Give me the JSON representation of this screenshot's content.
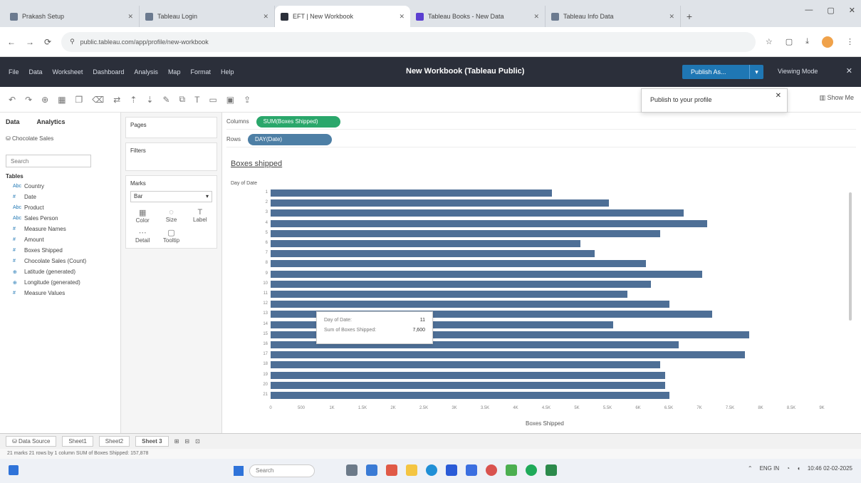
{
  "browser": {
    "tabs": [
      {
        "title": "Prakash Setup"
      },
      {
        "title": "Tableau Login"
      },
      {
        "title": "EFT | New Workbook"
      },
      {
        "title": "Tableau Books - New Data"
      },
      {
        "title": "Tableau Info Data"
      }
    ],
    "url": "public.tableau.com/app/profile/new-workbook",
    "new_tab": "+"
  },
  "tableau": {
    "menus": [
      "File",
      "Data",
      "Worksheet",
      "Dashboard",
      "Analysis",
      "Map",
      "Format",
      "Help"
    ],
    "workbook_title": "New Workbook (Tableau Public)",
    "publish_label": "Publish As...",
    "user": "Viewing Mode",
    "publish_tooltip": "Publish to your profile",
    "show_me": "Show Me"
  },
  "data_pane": {
    "tab_data": "Data",
    "tab_analytics": "Analytics",
    "source": "Chocolate Sales",
    "search_placeholder": "Search",
    "tables_label": "Tables",
    "fields": [
      {
        "type": "Abc",
        "name": "Country"
      },
      {
        "type": "#",
        "name": "Date"
      },
      {
        "type": "Abc",
        "name": "Product"
      },
      {
        "type": "Abc",
        "name": "Sales Person"
      },
      {
        "type": "#",
        "name": "Measure Names"
      },
      {
        "type": "#",
        "name": "Amount"
      },
      {
        "type": "#",
        "name": "Boxes Shipped"
      },
      {
        "type": "#",
        "name": "Chocolate Sales (Count)"
      },
      {
        "type": "⊕",
        "name": "Latitude (generated)"
      },
      {
        "type": "⊕",
        "name": "Longitude (generated)"
      },
      {
        "type": "#",
        "name": "Measure Values"
      }
    ]
  },
  "cards": {
    "pages": "Pages",
    "filters": "Filters",
    "marks": "Marks",
    "mark_type": "Bar",
    "mark_buttons": [
      {
        "icon": "▦",
        "label": "Color"
      },
      {
        "icon": "◌",
        "label": "Size"
      },
      {
        "icon": "T",
        "label": "Label"
      },
      {
        "icon": "⋯",
        "label": "Detail"
      },
      {
        "icon": "▢",
        "label": "Tooltip"
      }
    ]
  },
  "shelves": {
    "columns_label": "Columns",
    "columns_pill": "SUM(Boxes Shipped)",
    "rows_label": "Rows",
    "rows_pill": "DAY(Date)"
  },
  "chart_data": {
    "type": "bar",
    "title": "Boxes shipped",
    "ylabel": "Day of Date",
    "xlabel": "Boxes Shipped",
    "categories": [
      "1",
      "2",
      "3",
      "4",
      "5",
      "6",
      "7",
      "8",
      "9",
      "10",
      "11",
      "12",
      "13",
      "14",
      "15",
      "16",
      "17",
      "18",
      "19",
      "20",
      "21"
    ],
    "values": [
      6000,
      7200,
      8800,
      9300,
      8300,
      6600,
      6900,
      8000,
      9200,
      8100,
      7600,
      8500,
      9400,
      7300,
      10200,
      8700,
      10100,
      8300,
      8400,
      8400,
      8500
    ],
    "xlim": [
      0,
      11500
    ],
    "xticks": [
      "0",
      "500",
      "1K",
      "1.5K",
      "2K",
      "2.5K",
      "3K",
      "3.5K",
      "4K",
      "4.5K",
      "5K",
      "5.5K",
      "6K",
      "6.5K",
      "7K",
      "7.5K",
      "8K",
      "8.5K",
      "9K"
    ],
    "orientation": "horizontal",
    "bar_color": "#4e6f96"
  },
  "tooltip": {
    "row1_label": "Day of Date:",
    "row1_value": "11",
    "row2_label": "Sum of Boxes Shipped:",
    "row2_value": "7,600"
  },
  "sheet_tabs": {
    "data_source": "Data Source",
    "sheets": [
      "Sheet1",
      "Sheet2",
      "Sheet 3"
    ],
    "active_index": 2
  },
  "status": "21 marks  21 rows by 1 column  SUM of Boxes Shipped: 157,878",
  "taskbar": {
    "search": "Search",
    "time": "10:46",
    "date": "02-02-2025",
    "lang": "ENG IN"
  }
}
